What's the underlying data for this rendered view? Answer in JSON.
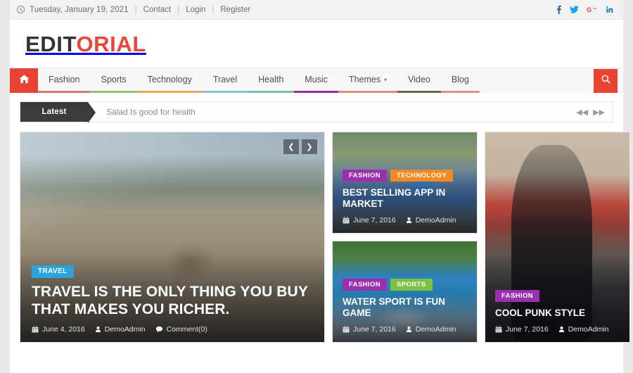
{
  "topbar": {
    "clock_icon": "clock-icon",
    "date": "Tuesday, January 19, 2021",
    "separator": "|",
    "links": [
      {
        "label": "Contact"
      },
      {
        "label": "Login"
      },
      {
        "label": "Register"
      }
    ],
    "socials": [
      {
        "name": "facebook-icon",
        "color": "#3b5998"
      },
      {
        "name": "twitter-icon",
        "color": "#1da1f2"
      },
      {
        "name": "google-plus-icon",
        "color": "#db4437"
      },
      {
        "name": "linkedin-icon",
        "color": "#0077b5"
      }
    ]
  },
  "brand": {
    "part1": "EDIT",
    "part2": "ORIAL",
    "color_dark": "#333333",
    "color_red": "#ec4436"
  },
  "nav": {
    "home_icon": "home-icon",
    "home_bg": "#ea4335",
    "search_icon": "search-icon",
    "items": [
      {
        "label": "Fashion",
        "underline": "#d9776e",
        "has_caret": false
      },
      {
        "label": "Sports",
        "underline": "#8ec37a",
        "has_caret": false
      },
      {
        "label": "Technology",
        "underline": "#e8a85c",
        "has_caret": false
      },
      {
        "label": "Travel",
        "underline": "#86c2de",
        "has_caret": false
      },
      {
        "label": "Health",
        "underline": "#74bfae",
        "has_caret": false
      },
      {
        "label": "Music",
        "underline": "#9b2d9b",
        "has_caret": false
      },
      {
        "label": "Themes",
        "underline": "#e08a78",
        "has_caret": true
      },
      {
        "label": "Video",
        "underline": "#6e6a42",
        "has_caret": false
      },
      {
        "label": "Blog",
        "underline": "#e09184",
        "has_caret": false
      }
    ]
  },
  "ticker": {
    "label": "Latest",
    "text": "Salad Is good for health",
    "prev_icon": "double-arrow-left-icon",
    "next_icon": "double-arrow-right-icon"
  },
  "slider": {
    "prev_icon": "chevron-left-icon",
    "next_icon": "chevron-right-icon"
  },
  "cards": {
    "hero": {
      "badges": [
        {
          "label": "TRAVEL",
          "color": "#2ba3dd"
        }
      ],
      "title": "TRAVEL IS THE ONLY THING YOU BUY THAT MAKES YOU RICHER.",
      "date": "June 4, 2016",
      "author": "DemoAdmin",
      "comments": "Comment(0)",
      "date_icon": "calendar-icon",
      "author_icon": "user-icon",
      "comment_icon": "comment-icon"
    },
    "app": {
      "badges": [
        {
          "label": "FASHION",
          "color": "#9b2fae"
        },
        {
          "label": "TECHNOLOGY",
          "color": "#f08a22"
        }
      ],
      "title": "BEST SELLING APP IN MARKET",
      "date": "June 7, 2016",
      "author": "DemoAdmin",
      "date_icon": "calendar-icon",
      "author_icon": "user-icon"
    },
    "water": {
      "badges": [
        {
          "label": "FASHION",
          "color": "#9b2fae"
        },
        {
          "label": "SPORTS",
          "color": "#7cc242"
        }
      ],
      "title": "WATER SPORT IS FUN GAME",
      "date": "June 7, 2016",
      "author": "DemoAdmin",
      "date_icon": "calendar-icon",
      "author_icon": "user-icon"
    },
    "punk": {
      "badges": [
        {
          "label": "FASHION",
          "color": "#9b2fae"
        }
      ],
      "title": "COOL PUNK STYLE",
      "date": "June 7, 2016",
      "author": "DemoAdmin",
      "date_icon": "calendar-icon",
      "author_icon": "user-icon"
    }
  }
}
